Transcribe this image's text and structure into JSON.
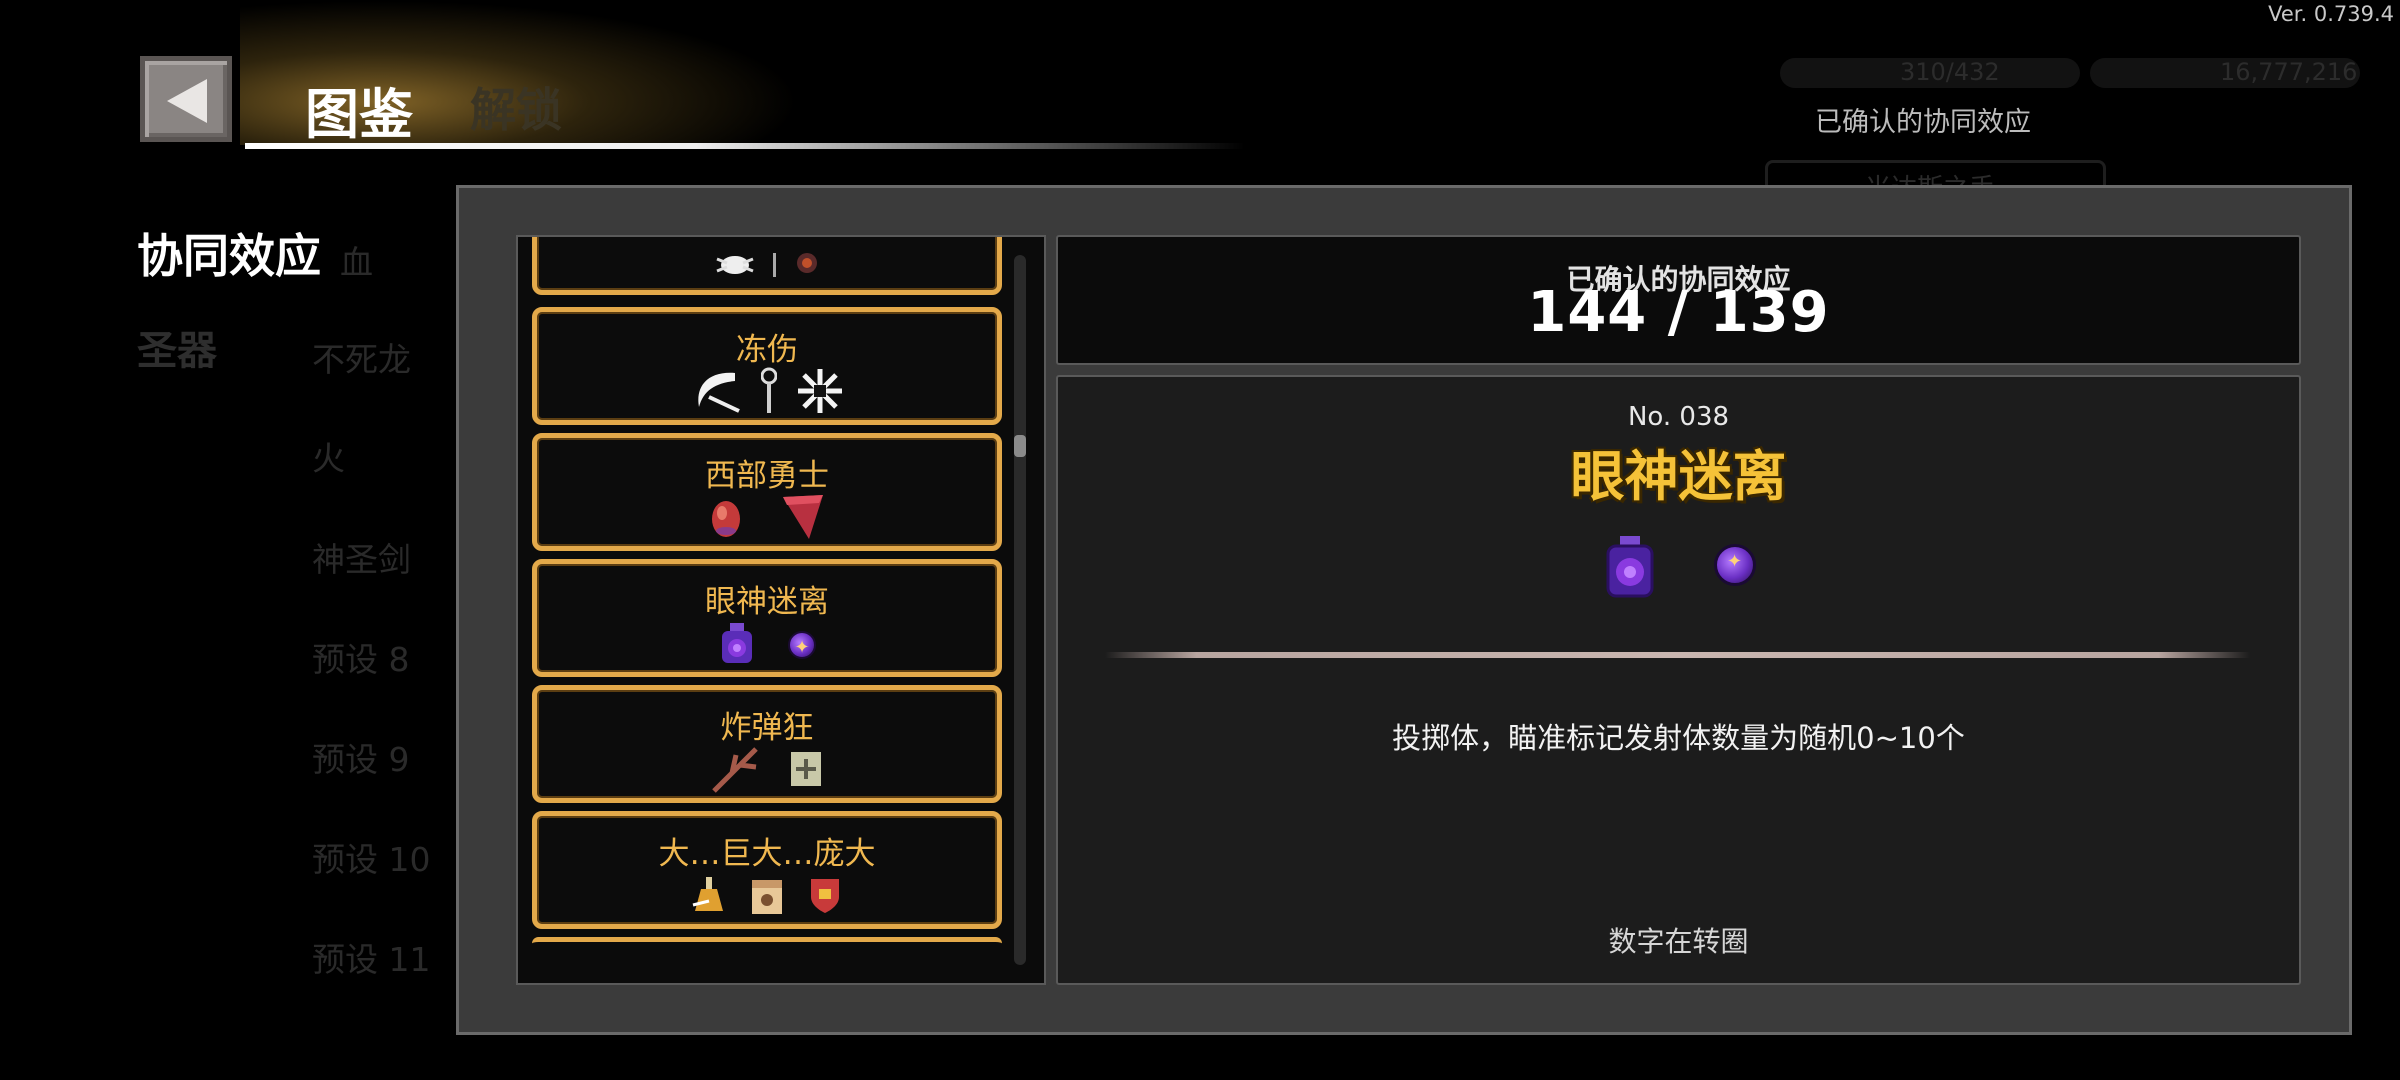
{
  "version": "Ver. 0.739.4",
  "header": {
    "title": "图鉴",
    "ghost_tab": "解锁"
  },
  "currency": {
    "gems": "310/432",
    "coins": "16,777,216"
  },
  "background": {
    "confirmed_label": "已确认的协同效应",
    "ghost_box_text": "米达斯之手"
  },
  "sidebar": {
    "synergy": "协同效应",
    "artifact": "圣器",
    "items": [
      "血",
      "不死龙",
      "火",
      "神圣剑",
      "预设 8",
      "预设 9",
      "预设 10",
      "预设 11"
    ]
  },
  "synergy_list": [
    {
      "name": "冻伤",
      "icons": [
        "scythe-icon",
        "wand-icon",
        "snowflake-icon"
      ]
    },
    {
      "name": "西部勇士",
      "icons": [
        "egg-icon",
        "bandana-icon"
      ]
    },
    {
      "name": "眼神迷离",
      "icons": [
        "potion-icon",
        "purple-orb-icon"
      ]
    },
    {
      "name": "炸弹狂",
      "icons": [
        "branch-icon",
        "scroll-icon"
      ]
    },
    {
      "name": "大…巨大…庞大",
      "icons": [
        "flask-icon",
        "paper-bag-icon",
        "shield-icon"
      ]
    }
  ],
  "counter": {
    "label": "已确认的协同效应",
    "value": "144 / 139"
  },
  "detail": {
    "number": "No. 038",
    "name": "眼神迷离",
    "icons": [
      "potion-icon",
      "purple-orb-icon"
    ],
    "description": "投掷体，瞄准标记发射体数量为随机0~10个",
    "footer": "数字在转圈"
  },
  "colors": {
    "card_border": "#e3a94a",
    "card_title": "#f0b850",
    "detail_name": "#f5c238",
    "modal_bg": "#3b3b3b"
  }
}
